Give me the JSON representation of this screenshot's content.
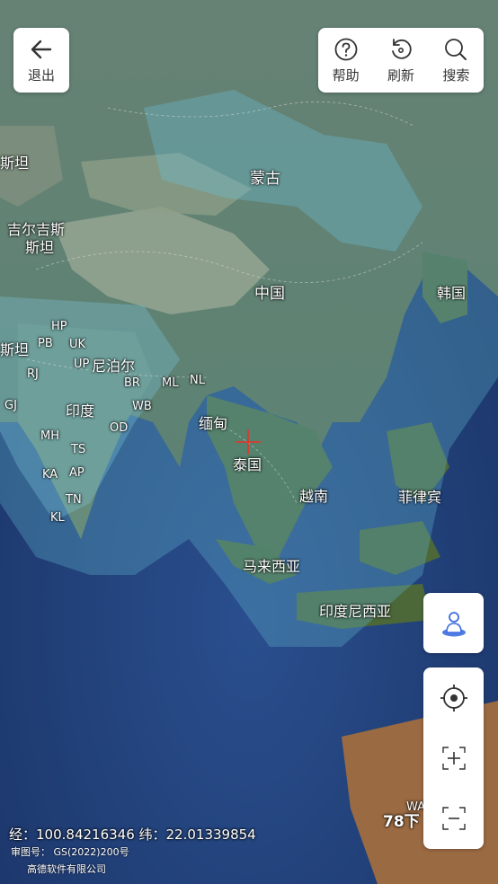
{
  "toolbar": {
    "back_label": "退出",
    "help_label": "帮助",
    "refresh_label": "刷新",
    "search_label": "搜索"
  },
  "map_labels": {
    "mongolia": "蒙古",
    "china": "中国",
    "korea": "韩国",
    "kyrgyzstan_1": "吉尔吉斯",
    "kyrgyzstan_2": "斯坦",
    "stan_top": "斯坦",
    "stan_mid": "斯坦",
    "nepal": "尼泊尔",
    "india": "印度",
    "myanmar": "缅甸",
    "thailand": "泰国",
    "vietnam": "越南",
    "philippines": "菲律宾",
    "malaysia": "马来西亚",
    "indonesia": "印度尼西亚",
    "hp": "HP",
    "pb": "PB",
    "uk": "UK",
    "up": "UP",
    "rj": "RJ",
    "br": "BR",
    "ml": "ML",
    "nl": "NL",
    "gj": "GJ",
    "wb": "WB",
    "od": "OD",
    "mh": "MH",
    "ts": "TS",
    "ka": "KA",
    "ap": "AP",
    "tn": "TN",
    "kl": "KL",
    "wa": "WA"
  },
  "status": {
    "coordinates": "经：100.84216346 纬：22.01339854",
    "review_number": "审图号： GS(2022)200号",
    "company": "高德软件有限公司",
    "scale": "78下"
  },
  "colors": {
    "ocean": "#1f3f7a",
    "overlay": "#5fb0c8",
    "crosshair": "#e8322a",
    "accent": "#3d6ee0"
  },
  "icons": {
    "back": "arrow-left-icon",
    "help": "question-circle-icon",
    "refresh": "refresh-icon",
    "search": "search-icon",
    "person": "person-location-icon",
    "locate": "locate-target-icon",
    "zoom_in": "zoom-in-icon",
    "zoom_out": "zoom-out-icon"
  }
}
